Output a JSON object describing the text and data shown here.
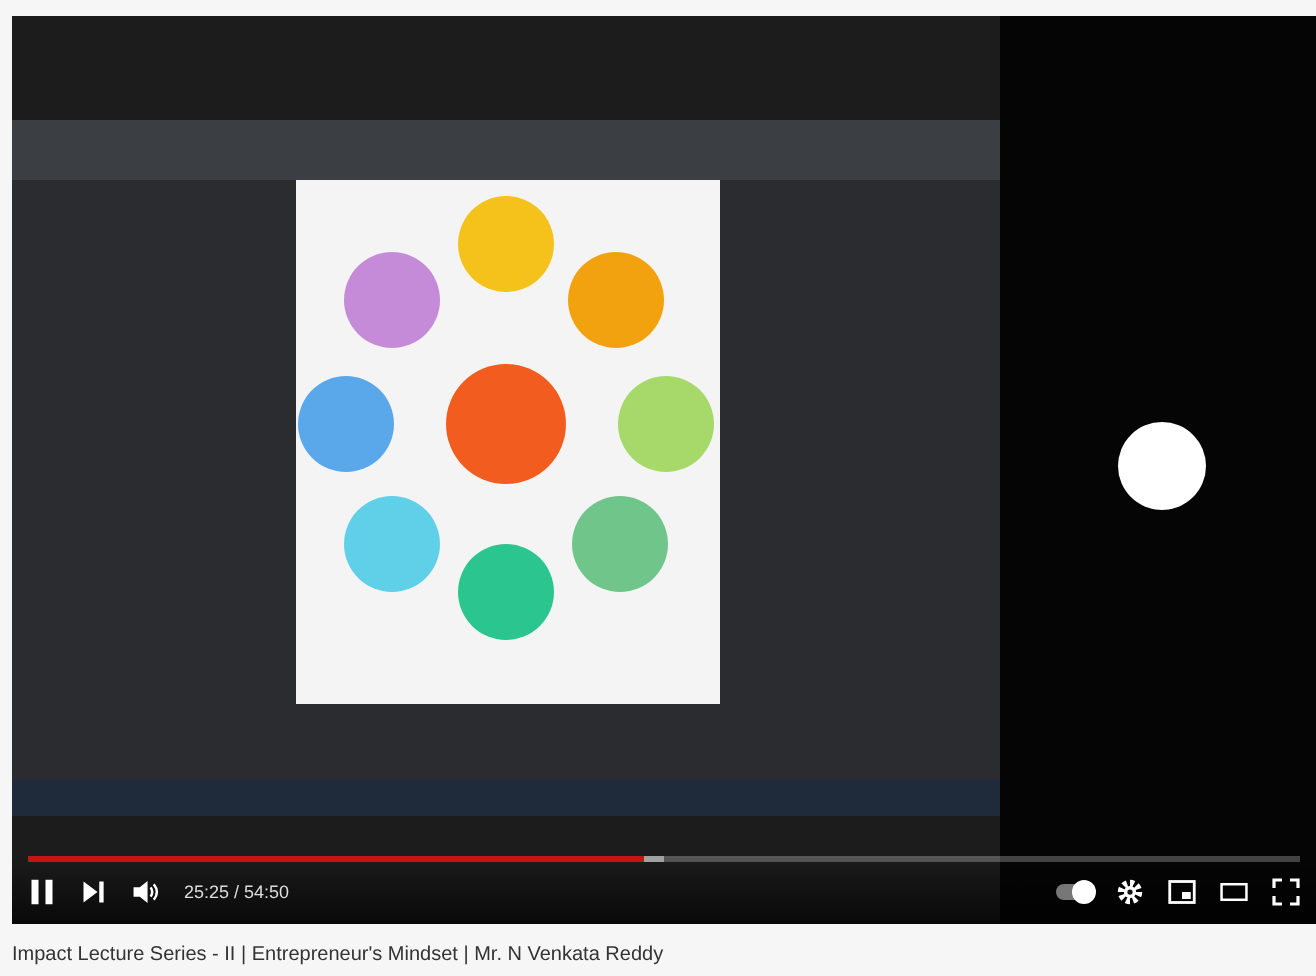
{
  "player": {
    "progress": {
      "level": 0.485
    },
    "time": "25:25 / 54:50",
    "playing": true,
    "autoplay": {
      "on": true
    }
  },
  "title": "Impact Lecture Series - II | Entrepreneur's Mindset | Mr. N Venkata Reddy"
}
